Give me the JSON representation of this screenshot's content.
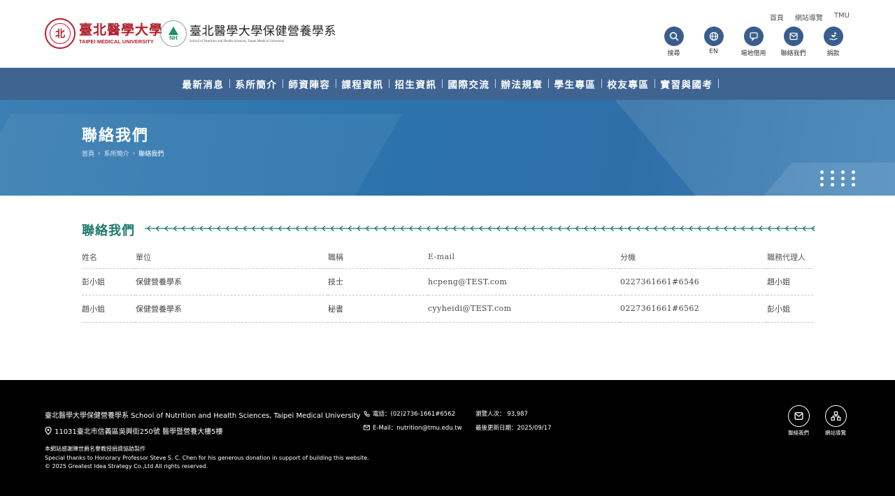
{
  "header": {
    "logo_tmu": {
      "zh": "臺北醫學大學",
      "en": "TAIPEI MEDICAL UNIVERSITY",
      "seal_char": "北"
    },
    "logo_nh": {
      "zh": "臺北醫學大學保健營養學系",
      "en": "School of Nutrition and Health Sciences, Taipei Medical University",
      "badge": "NH"
    },
    "top_links": [
      "首頁",
      "網站導覽",
      "TMU"
    ],
    "tools": [
      {
        "label": "搜尋",
        "icon": "search-icon"
      },
      {
        "label": "EN",
        "icon": "globe-icon"
      },
      {
        "label": "場地借用",
        "icon": "chat-icon"
      },
      {
        "label": "聯絡我們",
        "icon": "mail-icon"
      },
      {
        "label": "捐款",
        "icon": "donate-icon"
      }
    ]
  },
  "nav": [
    "最新消息",
    "系所簡介",
    "師資陣容",
    "課程資訊",
    "招生資訊",
    "國際交流",
    "辦法規章",
    "學生專區",
    "校友專區",
    "實習與國考"
  ],
  "banner": {
    "title": "聯絡我們",
    "breadcrumb": [
      "首頁",
      "系所簡介",
      "聯絡我們"
    ]
  },
  "content": {
    "section_title": "聯絡我們",
    "table": {
      "headers": [
        "姓名",
        "單位",
        "職稱",
        "E-mail",
        "分機",
        "職務代理人"
      ],
      "rows": [
        [
          "彭小姐",
          "保健營養學系",
          "技士",
          "hcpeng@TEST.com",
          "0227361661#6546",
          "趙小姐"
        ],
        [
          "趙小姐",
          "保健營養學系",
          "秘書",
          "cyyheidi@TEST.com",
          "0227361661#6562",
          "彭小姐"
        ]
      ]
    }
  },
  "footer": {
    "school": "臺北醫學大學保健營養學系 School of Nutrition and Health Sciences, Taipei Medical University",
    "address": "11031臺北市信義區吳興街250號 醫學暨營養大樓5樓",
    "phone": "電話：(02)2736-1661#6562",
    "email": "E-Mail：nutrition@tmu.edu.tw",
    "visits": "瀏覽人次： 93,987",
    "updated": "最後更新日期：2025/09/17",
    "credit_zh": "本網站感謝陳世爵名譽教授捐資協助製作",
    "credit_en": "Special thanks to Honorary Professor Steve S. C. Chen for his generous donation in support of building this website.",
    "copyright": "© 2025 Greatest Idea Strategy Co.,Ltd All rights reserved.",
    "tools": [
      {
        "label": "聯絡我們",
        "icon": "mail-icon"
      },
      {
        "label": "網站導覽",
        "icon": "sitemap-icon"
      }
    ]
  },
  "colors": {
    "nav": "#3f6492",
    "banner": "#2c74ad",
    "accent": "#1f7a6e",
    "tmu_red": "#b3202a"
  }
}
